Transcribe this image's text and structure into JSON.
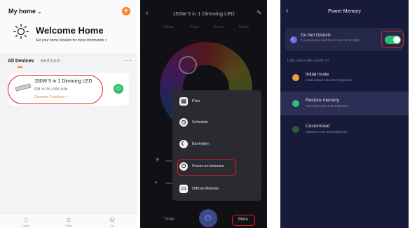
{
  "panel1": {
    "home_selector": "My home",
    "add_icon": "plus-icon",
    "welcome_title": "Welcome Home",
    "welcome_sub": "Set your home location for more information >",
    "tabs": [
      "All Devices",
      "Bedroom"
    ],
    "more": "···",
    "device": {
      "name": "150W 5 in 1 Dimming LED",
      "status": "ON  ☀1%  ◐0%  ⊙0s",
      "functions": "Common Functions >"
    },
    "nav": [
      "Home",
      "Smart",
      "Me"
    ],
    "colors": {
      "accent": "#ff7f2a",
      "power": "#2fbf71",
      "highlight": "#e02020"
    }
  },
  "panel2": {
    "title": "150W 5 in 1 Dimming LED",
    "tabs": [
      "White",
      "Color",
      "Scene",
      "Music"
    ],
    "slider1_pct": "1%",
    "slider2_pct": "0%",
    "menu": [
      {
        "icon": "plan-icon",
        "label": "Plan"
      },
      {
        "icon": "clock-icon",
        "label": "Schedule"
      },
      {
        "icon": "biorhythm-icon",
        "label": "Biorhythm"
      },
      {
        "icon": "power-on-icon",
        "label": "Power-on behavior"
      },
      {
        "icon": "website-icon",
        "label": "Official Website"
      }
    ],
    "bottom": {
      "timer": "Timer",
      "more": "More"
    }
  },
  "panel3": {
    "title": "Power Memory",
    "dnd": {
      "title": "Do Not Disturb",
      "sub": "2 consecutive switches to turn on the light",
      "enabled": true
    },
    "section_label": "Light status after power on",
    "options": [
      {
        "title": "Initial mode",
        "sub": "Initial default color and brightness",
        "color": "#e8a23a",
        "selected": false
      },
      {
        "title": "Restore memory",
        "sub": "Last used color and brightness",
        "color": "#2fbf71",
        "selected": true
      },
      {
        "title": "Customized",
        "sub": "Selected color and brightness",
        "color": "#2f5a38",
        "selected": false
      }
    ]
  }
}
